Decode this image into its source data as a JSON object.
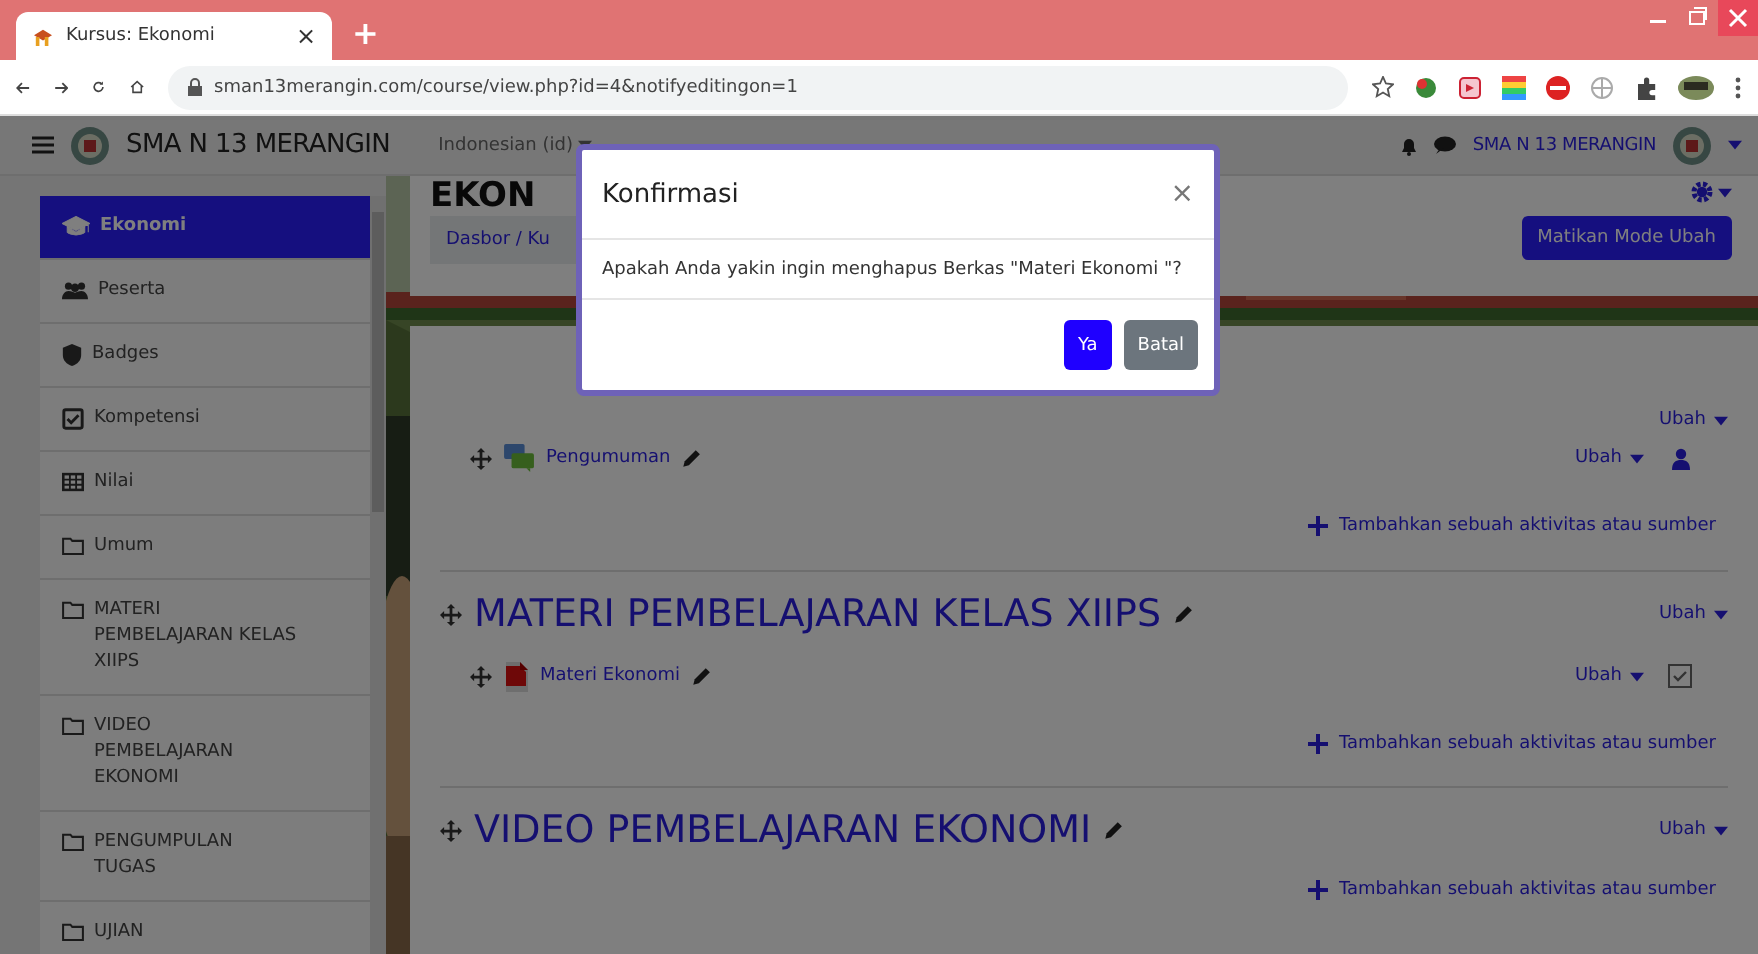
{
  "browser": {
    "tab_title": "Kursus: Ekonomi",
    "tab_close": "×",
    "new_tab": "+",
    "url": "sman13merangin.com/course/view.php?id=4&notifyeditingon=1"
  },
  "navbar": {
    "site_name": "SMA N 13 MERANGIN",
    "language": "Indonesian (id)",
    "user_name": "SMA N 13 MERANGIN"
  },
  "sidebar": {
    "items": [
      {
        "label": "Ekonomi",
        "kind": "course",
        "selected": true
      },
      {
        "label": "Peserta",
        "kind": "users",
        "selected": false
      },
      {
        "label": "Badges",
        "kind": "shield",
        "selected": false
      },
      {
        "label": "Kompetensi",
        "kind": "check",
        "selected": false
      },
      {
        "label": "Nilai",
        "kind": "table",
        "selected": false
      },
      {
        "label": "Umum",
        "kind": "folder",
        "selected": false
      },
      {
        "label": "MATERI\nPEMBELAJARAN KELAS\nXIIPS",
        "kind": "folder",
        "selected": false
      },
      {
        "label": "VIDEO\nPEMBELAJARAN\nEKONOMI",
        "kind": "folder",
        "selected": false
      },
      {
        "label": "PENGUMPULAN\nTUGAS",
        "kind": "folder",
        "selected": false
      },
      {
        "label": "UJIAN",
        "kind": "folder",
        "selected": false
      }
    ]
  },
  "header": {
    "title": "EKON",
    "breadcrumb": "Dasbor / Ku",
    "edit_mode_button": "Matikan Mode Ubah"
  },
  "sections": [
    {
      "edit_menu": "Ubah",
      "activities": [
        {
          "name": "Pengumuman",
          "kind": "forum",
          "edit_menu": "Ubah",
          "status": {
            "kind": "person"
          }
        }
      ],
      "add_link": "Tambahkan sebuah aktivitas atau sumber"
    },
    {
      "title": "MATERI PEMBELAJARAN KELAS XIIPS",
      "edit_menu": "Ubah",
      "activities": [
        {
          "name": "Materi Ekonomi",
          "kind": "file",
          "edit_menu": "Ubah",
          "status": {
            "kind": "checkbox"
          }
        }
      ],
      "add_link": "Tambahkan sebuah aktivitas atau sumber"
    },
    {
      "title": "VIDEO PEMBELAJARAN EKONOMI",
      "edit_menu": "Ubah",
      "add_link": "Tambahkan sebuah aktivitas atau sumber"
    }
  ],
  "dialog": {
    "title": "Konfirmasi",
    "close": "×",
    "message": "Apakah Anda yakin ingin menghapus Berkas \"Materi Ekonomi \"?",
    "buttons": [
      {
        "label": "Ya",
        "kind": "primary"
      },
      {
        "label": "Batal",
        "kind": "secondary"
      }
    ]
  }
}
